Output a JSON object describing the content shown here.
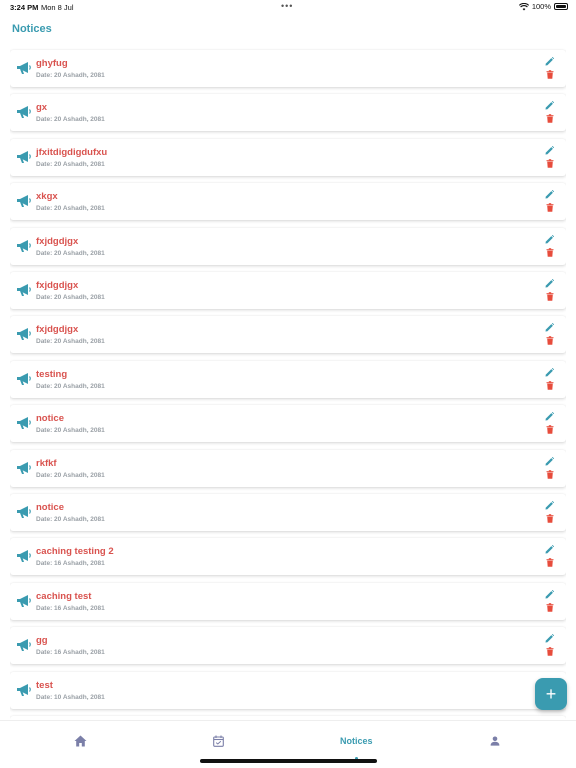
{
  "status_bar": {
    "time": "3:24 PM",
    "date": "Mon 8 Jul",
    "battery": "100%"
  },
  "header": {
    "title": "Notices"
  },
  "notices": [
    {
      "title": "ghyfug",
      "date": "Date: 20 Ashadh, 2081"
    },
    {
      "title": "gx",
      "date": "Date: 20 Ashadh, 2081"
    },
    {
      "title": "jfxitdigdigdufxu",
      "date": "Date: 20 Ashadh, 2081"
    },
    {
      "title": "xkgx",
      "date": "Date: 20 Ashadh, 2081"
    },
    {
      "title": "fxjdgdjgx",
      "date": "Date: 20 Ashadh, 2081"
    },
    {
      "title": "fxjdgdjgx",
      "date": "Date: 20 Ashadh, 2081"
    },
    {
      "title": "fxjdgdjgx",
      "date": "Date: 20 Ashadh, 2081"
    },
    {
      "title": "testing",
      "date": "Date: 20 Ashadh, 2081"
    },
    {
      "title": "notice",
      "date": "Date: 20 Ashadh, 2081"
    },
    {
      "title": "rkfkf",
      "date": "Date: 20 Ashadh, 2081"
    },
    {
      "title": "notice",
      "date": "Date: 20 Ashadh, 2081"
    },
    {
      "title": "caching testing 2",
      "date": "Date: 16 Ashadh, 2081"
    },
    {
      "title": "caching test",
      "date": "Date: 16 Ashadh, 2081"
    },
    {
      "title": "gg",
      "date": "Date: 16 Ashadh, 2081"
    },
    {
      "title": "test",
      "date": "Date: 10 Ashadh, 2081"
    }
  ],
  "fab": {
    "label": "+"
  },
  "tabbar": {
    "active": "Notices",
    "notices_label": "Notices"
  },
  "colors": {
    "accent": "#3a9bb0",
    "title_red": "#d9534f",
    "delete_red": "#e74c3c",
    "date_gray": "#9aa0a6",
    "tab_icon_inactive": "#7b7fa8"
  },
  "icons": {
    "notice": "megaphone-icon",
    "edit": "pencil-icon",
    "delete": "trash-icon",
    "home": "home-icon",
    "calendar": "calendar-check-icon",
    "profile": "person-icon",
    "wifi": "wifi-icon",
    "battery": "battery-icon"
  }
}
